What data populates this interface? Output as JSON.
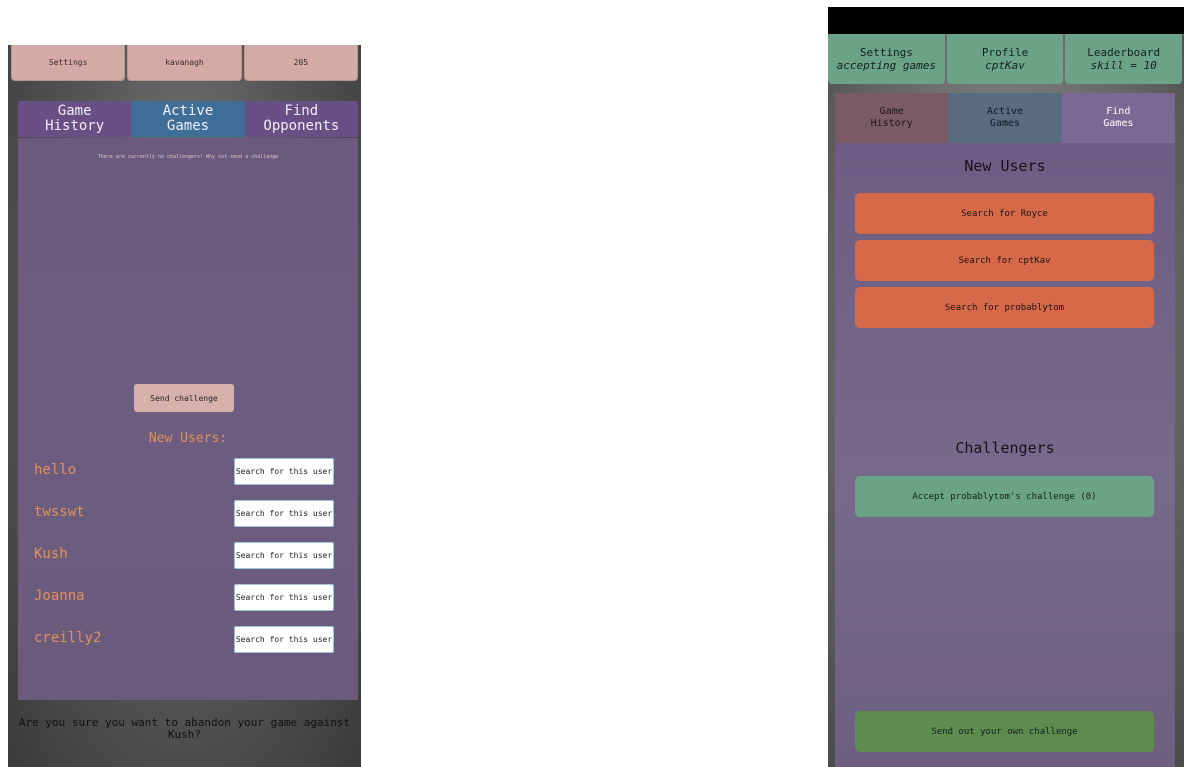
{
  "left": {
    "topbar": {
      "settings": "Settings",
      "username": "kavanagh",
      "score": "205"
    },
    "tabs": {
      "history": "Game\nHistory",
      "active": "Active\nGames",
      "find": "Find\nOpponents"
    },
    "no_challengers": "There are currently no challengers! Why not send a challenge",
    "send_challenge": "Send challenge",
    "new_users_heading": "New Users:",
    "search_label": "Search for this user",
    "users": [
      {
        "name": "hello"
      },
      {
        "name": "twsswt"
      },
      {
        "name": "Kush"
      },
      {
        "name": "Joanna"
      },
      {
        "name": "creilly2"
      }
    ],
    "bottom_prompt": "Are you sure you want to abandon your game against Kush?"
  },
  "right": {
    "topbar": {
      "settings": "Settings",
      "settings_sub": "accepting games",
      "profile": "Profile",
      "profile_sub": "cptKav",
      "leaderboard": "Leaderboard",
      "leaderboard_sub": "skill = 10"
    },
    "tabs": {
      "history": "Game\nHistory",
      "active": "Active\nGames",
      "find": "Find\nGames"
    },
    "new_users_heading": "New Users",
    "searches": [
      "Search for Royce",
      "Search for cptKav",
      "Search for probablytom"
    ],
    "challengers_heading": "Challengers",
    "accept_challenge": "Accept probablytom's challenge (0)",
    "send_own": "Send out your own challenge"
  },
  "colors": {
    "left_topbar": "#d4aaa6",
    "left_tab_active": "#3f6f98",
    "left_tab": "#6a4f86",
    "accent_orange": "#e0915a",
    "right_topbar": "#6ba389",
    "search_button": "#d6694a",
    "accept_button": "#6ba387",
    "send_own_button": "#5e8b4f"
  }
}
